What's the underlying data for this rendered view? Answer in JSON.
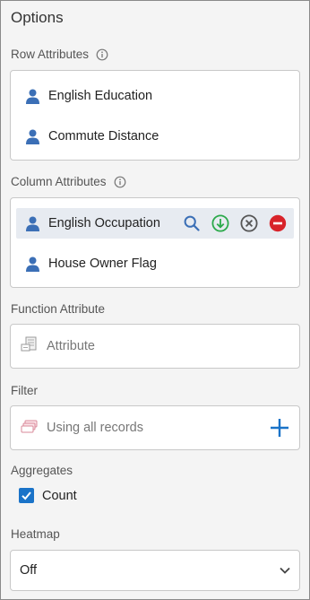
{
  "panel": {
    "title": "Options"
  },
  "row_attributes": {
    "label": "Row Attributes",
    "items": [
      {
        "label": "English Education",
        "icon": "person-icon"
      },
      {
        "label": "Commute Distance",
        "icon": "person-icon"
      }
    ]
  },
  "column_attributes": {
    "label": "Column Attributes",
    "items": [
      {
        "label": "English Occupation",
        "icon": "person-icon",
        "selected": true,
        "actions": [
          "search-icon",
          "move-down-icon",
          "clear-icon",
          "remove-icon"
        ]
      },
      {
        "label": "House Owner Flag",
        "icon": "person-icon"
      }
    ]
  },
  "function_attribute": {
    "label": "Function Attribute",
    "placeholder": "Attribute",
    "icon": "attribute-icon"
  },
  "filter": {
    "label": "Filter",
    "value": "Using all records",
    "icon": "records-icon",
    "add_icon": "plus-icon"
  },
  "aggregates": {
    "label": "Aggregates",
    "items": [
      {
        "label": "Count",
        "checked": true
      }
    ]
  },
  "heatmap": {
    "label": "Heatmap",
    "value": "Off",
    "icon": "chevron-down-icon"
  },
  "colors": {
    "accent": "#1a73c8",
    "person_icon": "#3b6fb6",
    "selected_row": "#e7ebf1",
    "move_down": "#2aa94a",
    "remove": "#d8232a",
    "clear": "#555555"
  }
}
